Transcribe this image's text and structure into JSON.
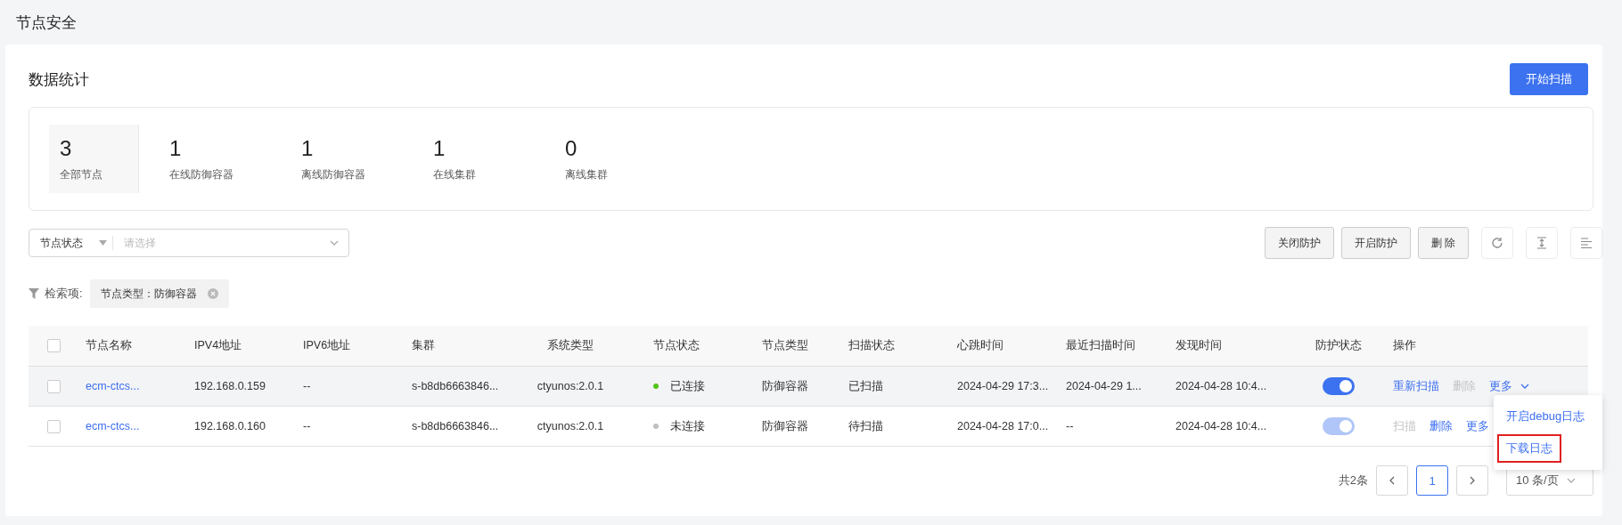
{
  "page_title": "节点安全",
  "section": {
    "title": "数据统计",
    "primary_button": "开始扫描"
  },
  "stats": [
    {
      "value": "3",
      "label": "全部节点",
      "selected": true
    },
    {
      "value": "1",
      "label": "在线防御容器",
      "selected": false
    },
    {
      "value": "1",
      "label": "离线防御容器",
      "selected": false
    },
    {
      "value": "1",
      "label": "在线集群",
      "selected": false
    },
    {
      "value": "0",
      "label": "离线集群",
      "selected": false
    }
  ],
  "filter": {
    "field_label": "节点状态",
    "placeholder": "请选择"
  },
  "toolbar": {
    "buttons": [
      "关闭防护",
      "开启防护",
      "删 除"
    ]
  },
  "search_tags": {
    "label": "检索项:",
    "tags": [
      "节点类型：防御容器"
    ]
  },
  "table": {
    "header_checked": false,
    "columns": [
      "节点名称",
      "IPV4地址",
      "IPV6地址",
      "集群",
      "系统类型",
      "节点状态",
      "节点类型",
      "扫描状态",
      "心跳时间",
      "最近扫描时间",
      "发现时间",
      "防护状态",
      "操作"
    ],
    "rows": [
      {
        "checked": false,
        "hovered": true,
        "name": "ecm-ctcs...",
        "ipv4": "192.168.0.159",
        "ipv6": "--",
        "cluster": "s-b8db6663846...",
        "os": "ctyunos:2.0.1",
        "status": {
          "text": "已连接",
          "color": "#52c41a"
        },
        "node_type": "防御容器",
        "scan_status": "已扫描",
        "heartbeat": "2024-04-29 17:3...",
        "last_scan": "2024-04-29 1...",
        "found": "2024-04-28 10:4...",
        "protection": {
          "on": true,
          "disabled": false
        },
        "actions": [
          {
            "label": "重新扫描",
            "kind": "link",
            "disabled": false
          },
          {
            "label": "删除",
            "kind": "link",
            "disabled": true
          },
          {
            "label": "更多",
            "kind": "dropdown",
            "disabled": false
          }
        ]
      },
      {
        "checked": false,
        "hovered": false,
        "name": "ecm-ctcs...",
        "ipv4": "192.168.0.160",
        "ipv6": "--",
        "cluster": "s-b8db6663846...",
        "os": "ctyunos:2.0.1",
        "status": {
          "text": "未连接",
          "color": "#bfbfbf"
        },
        "node_type": "防御容器",
        "scan_status": "待扫描",
        "heartbeat": "2024-04-28 17:0...",
        "last_scan": "--",
        "found": "2024-04-28 10:4...",
        "protection": {
          "on": true,
          "disabled": true
        },
        "actions": [
          {
            "label": "扫描",
            "kind": "link",
            "disabled": true
          },
          {
            "label": "删除",
            "kind": "link",
            "disabled": false
          },
          {
            "label": "更多",
            "kind": "link",
            "disabled": false
          }
        ]
      }
    ]
  },
  "dropdown_menu": {
    "items": [
      {
        "label": "开启debug日志",
        "highlighted": false
      },
      {
        "label": "下载日志",
        "highlighted": true
      }
    ]
  },
  "pagination": {
    "total": "共2条",
    "pages": [
      {
        "label": "1",
        "selected": true
      }
    ],
    "page_size": "10 条/页"
  }
}
